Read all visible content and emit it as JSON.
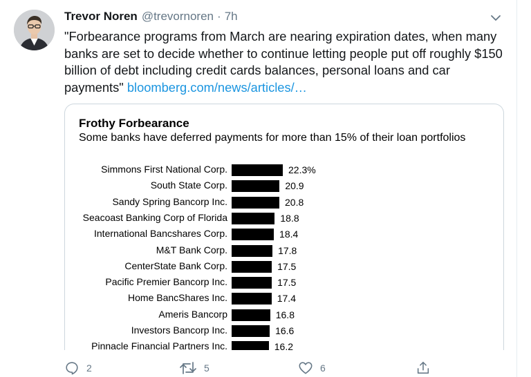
{
  "tweet": {
    "author_name": "Trevor Noren",
    "handle": "@trevornoren",
    "separator": "·",
    "time": "7h",
    "text": "\"Forbearance programs from March are nearing expiration dates, when many banks are set to decide whether to continue letting people put off roughly $150 billion of debt including credit cards balances, personal loans and car payments\"",
    "link_text": "bloomberg.com/news/articles/…"
  },
  "chart_data": {
    "type": "bar",
    "title": "Frothy Forbearance",
    "subtitle": "Some banks have deferred payments for more than 15% of their loan portfolios",
    "categories": [
      "Simmons First National Corp.",
      "South State Corp.",
      "Sandy Spring Bancorp Inc.",
      "Seacoast Banking Corp of Florida",
      "International Bancshares Corp.",
      "M&T Bank Corp.",
      "CenterState Bank Corp.",
      "Pacific Premier Bancorp Inc.",
      "Home BancShares Inc.",
      "Ameris Bancorp",
      "Investors Bancorp Inc.",
      "Pinnacle Financial Partners Inc."
    ],
    "values": [
      22.3,
      20.9,
      20.8,
      18.8,
      18.4,
      17.8,
      17.5,
      17.5,
      17.4,
      16.8,
      16.6,
      16.2
    ],
    "value_labels": [
      "22.3%",
      "20.9",
      "20.8",
      "18.8",
      "18.4",
      "17.8",
      "17.5",
      "17.5",
      "17.4",
      "16.8",
      "16.6",
      "16.2"
    ],
    "xlabel": "",
    "ylabel": "",
    "bar_color": "#000000"
  },
  "actions": {
    "reply_count": "2",
    "retweet_count": "5",
    "like_count": "6",
    "icons": [
      "reply-icon",
      "retweet-icon",
      "like-icon",
      "share-icon"
    ]
  },
  "colors": {
    "link": "#1b95e0",
    "muted": "#657786",
    "border": "#ccd6dd"
  }
}
